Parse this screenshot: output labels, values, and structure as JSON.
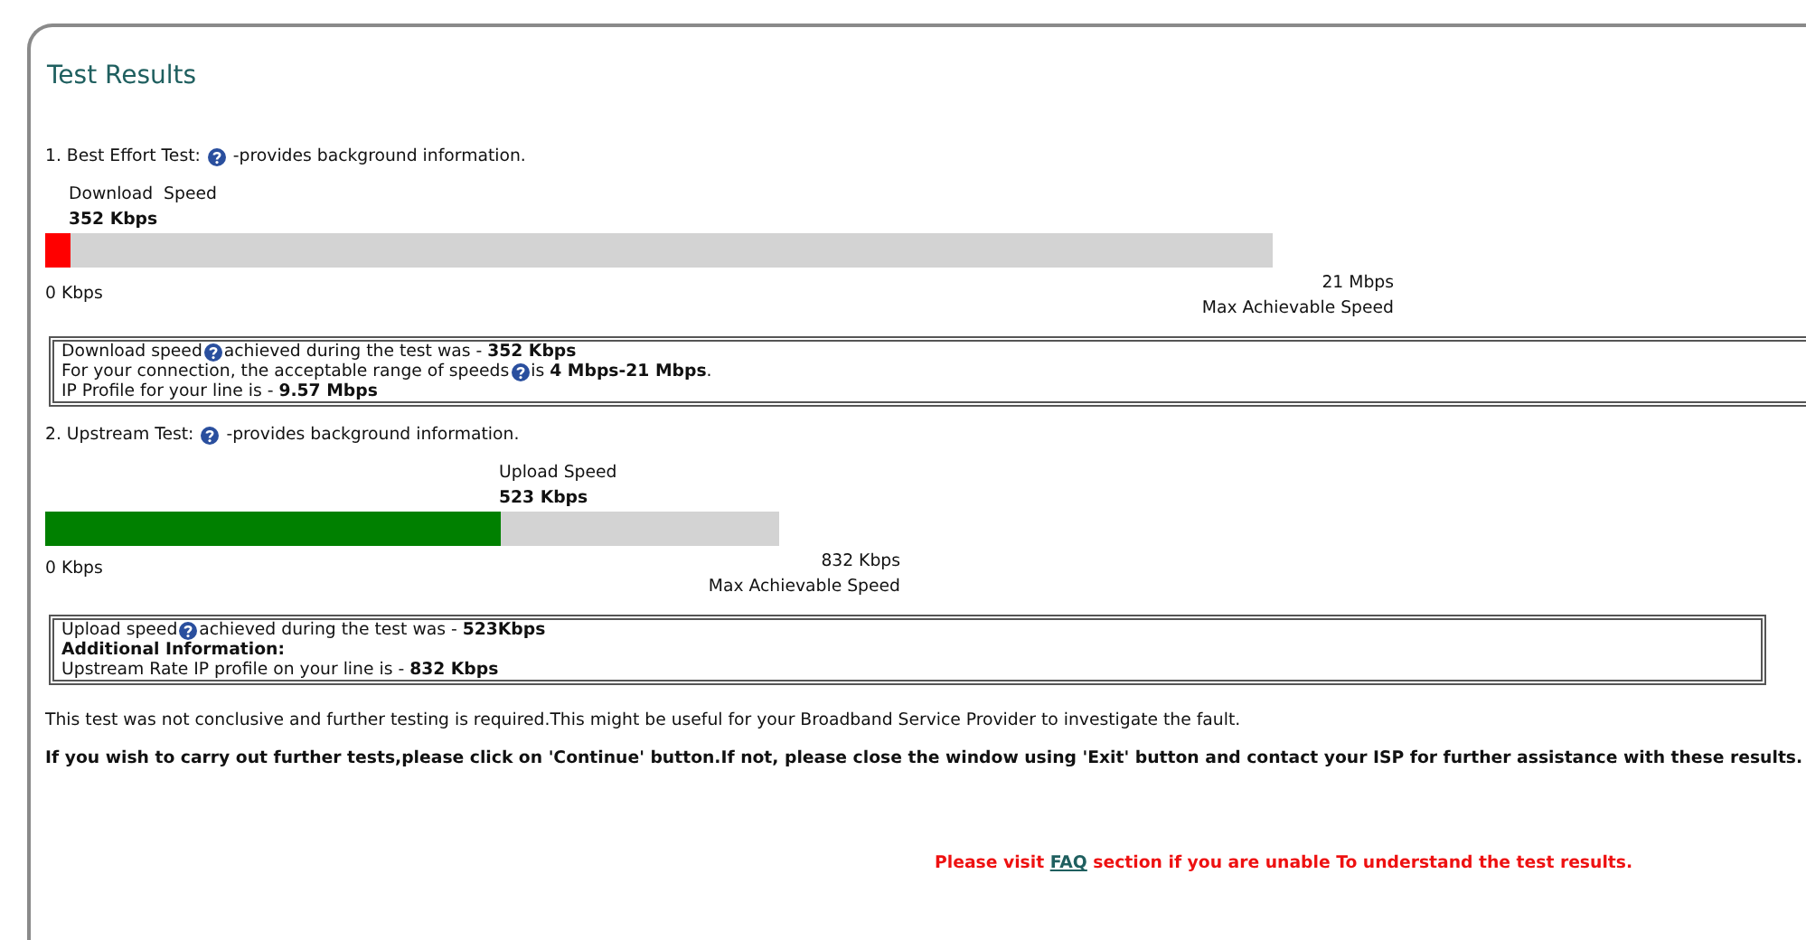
{
  "title": "Test Results",
  "sections": [
    {
      "heading": [
        {
          "kind": "text",
          "text": "1. Best Effort Test:"
        },
        {
          "kind": "help"
        },
        {
          "kind": "text",
          "text": "-provides background information."
        }
      ],
      "meter": {
        "label": "Download  Speed",
        "value": "352 Kbps",
        "level": 0.02,
        "color": "#ff0000",
        "min_label": "0 Kbps",
        "max_label": "21 Mbps",
        "max_caption": "Max Achievable Speed"
      },
      "info_lines": [
        {
          "bold": false,
          "parts": [
            {
              "kind": "text",
              "text": "Download speed"
            },
            {
              "kind": "help"
            },
            {
              "kind": "text",
              "text": "achieved during the test was - **352 Kbps**"
            }
          ]
        },
        {
          "bold": false,
          "parts": [
            {
              "kind": "text",
              "text": "For your connection, the acceptable range of speeds"
            },
            {
              "kind": "help"
            },
            {
              "kind": "text",
              "text": "is **4 Mbps-21 Mbps**."
            }
          ]
        },
        {
          "bold": false,
          "parts": [
            {
              "kind": "text",
              "text": "IP Profile for your line is - **9.57 Mbps**"
            }
          ]
        }
      ]
    },
    {
      "heading": [
        {
          "kind": "text",
          "text": "2. Upstream Test:"
        },
        {
          "kind": "help"
        },
        {
          "kind": "text",
          "text": "-provides background information."
        }
      ],
      "meter": {
        "label": "Upload Speed",
        "value": "523 Kbps",
        "level": 0.62,
        "color": "#008000",
        "min_label": "0 Kbps",
        "max_label": "832 Kbps",
        "max_caption": "Max Achievable Speed"
      },
      "info_lines": [
        {
          "bold": false,
          "parts": [
            {
              "kind": "text",
              "text": "Upload speed"
            },
            {
              "kind": "help"
            },
            {
              "kind": "text",
              "text": "achieved during the test was - **523Kbps**"
            }
          ]
        },
        {
          "bold": true,
          "parts": [
            {
              "kind": "text",
              "text": "Additional Information:"
            }
          ]
        },
        {
          "bold": false,
          "parts": [
            {
              "kind": "text",
              "text": "Upstream Rate IP profile on your line is - **832 Kbps**"
            }
          ]
        }
      ]
    }
  ],
  "note": "This test was not conclusive and further testing is required.This might be useful for your Broadband Service Provider to investigate the fault.",
  "instruction": "If you wish to carry out further tests,please click on 'Continue' button.If not, please close the window using 'Exit' button and contact your ISP for further assistance with these results.",
  "faq_notice": {
    "before": "Please visit ",
    "link": "FAQ",
    "after": " section if you are unable To understand the test results."
  }
}
